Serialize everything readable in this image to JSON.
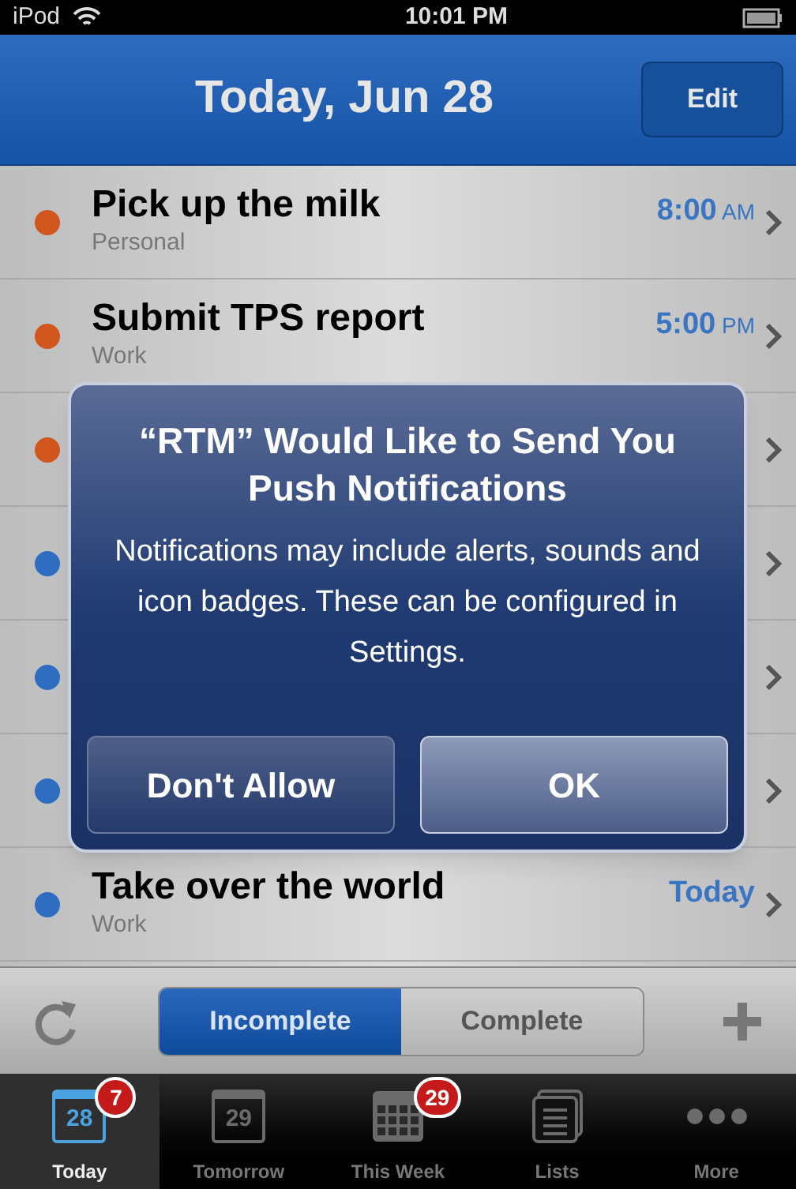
{
  "status_bar": {
    "carrier": "iPod",
    "time": "10:01 PM"
  },
  "nav": {
    "title": "Today, Jun 28",
    "edit_button": "Edit"
  },
  "tasks": [
    {
      "name": "Pick up the milk",
      "list": "Personal",
      "time": "8:00",
      "suffix": "AM",
      "color": "#d0561e"
    },
    {
      "name": "Submit TPS report",
      "list": "Work",
      "time": "5:00",
      "suffix": "PM",
      "color": "#d0561e"
    },
    {
      "color": "#d0561e"
    },
    {
      "color": "#2e6dbf"
    },
    {
      "color": "#2e6dbf"
    },
    {
      "color": "#2e6dbf"
    },
    {
      "name": "Take over the world",
      "list": "Work",
      "time": "Today",
      "color": "#2e6dbf"
    }
  ],
  "alert": {
    "title": "“RTM” Would Like to Send You Push Notifications",
    "message": "Notifications may include alerts, sounds and icon badges. These can be configured in Settings.",
    "buttons": [
      {
        "label": "Don't Allow",
        "kind": "cancel"
      },
      {
        "label": "OK",
        "kind": "default"
      }
    ]
  },
  "segments": [
    {
      "label": "Incomplete",
      "selected": true
    },
    {
      "label": "Complete",
      "selected": false
    }
  ],
  "tabs": [
    {
      "label": "Today",
      "kind": "calendar",
      "icon_text": "28",
      "badge": "7",
      "selected": true
    },
    {
      "label": "Tomorrow",
      "kind": "calendar",
      "icon_text": "29",
      "selected": false
    },
    {
      "label": "This Week",
      "kind": "grid",
      "badge": "29",
      "selected": false
    },
    {
      "label": "Lists",
      "kind": "lists",
      "selected": false
    },
    {
      "label": "More",
      "kind": "more",
      "selected": false
    }
  ]
}
